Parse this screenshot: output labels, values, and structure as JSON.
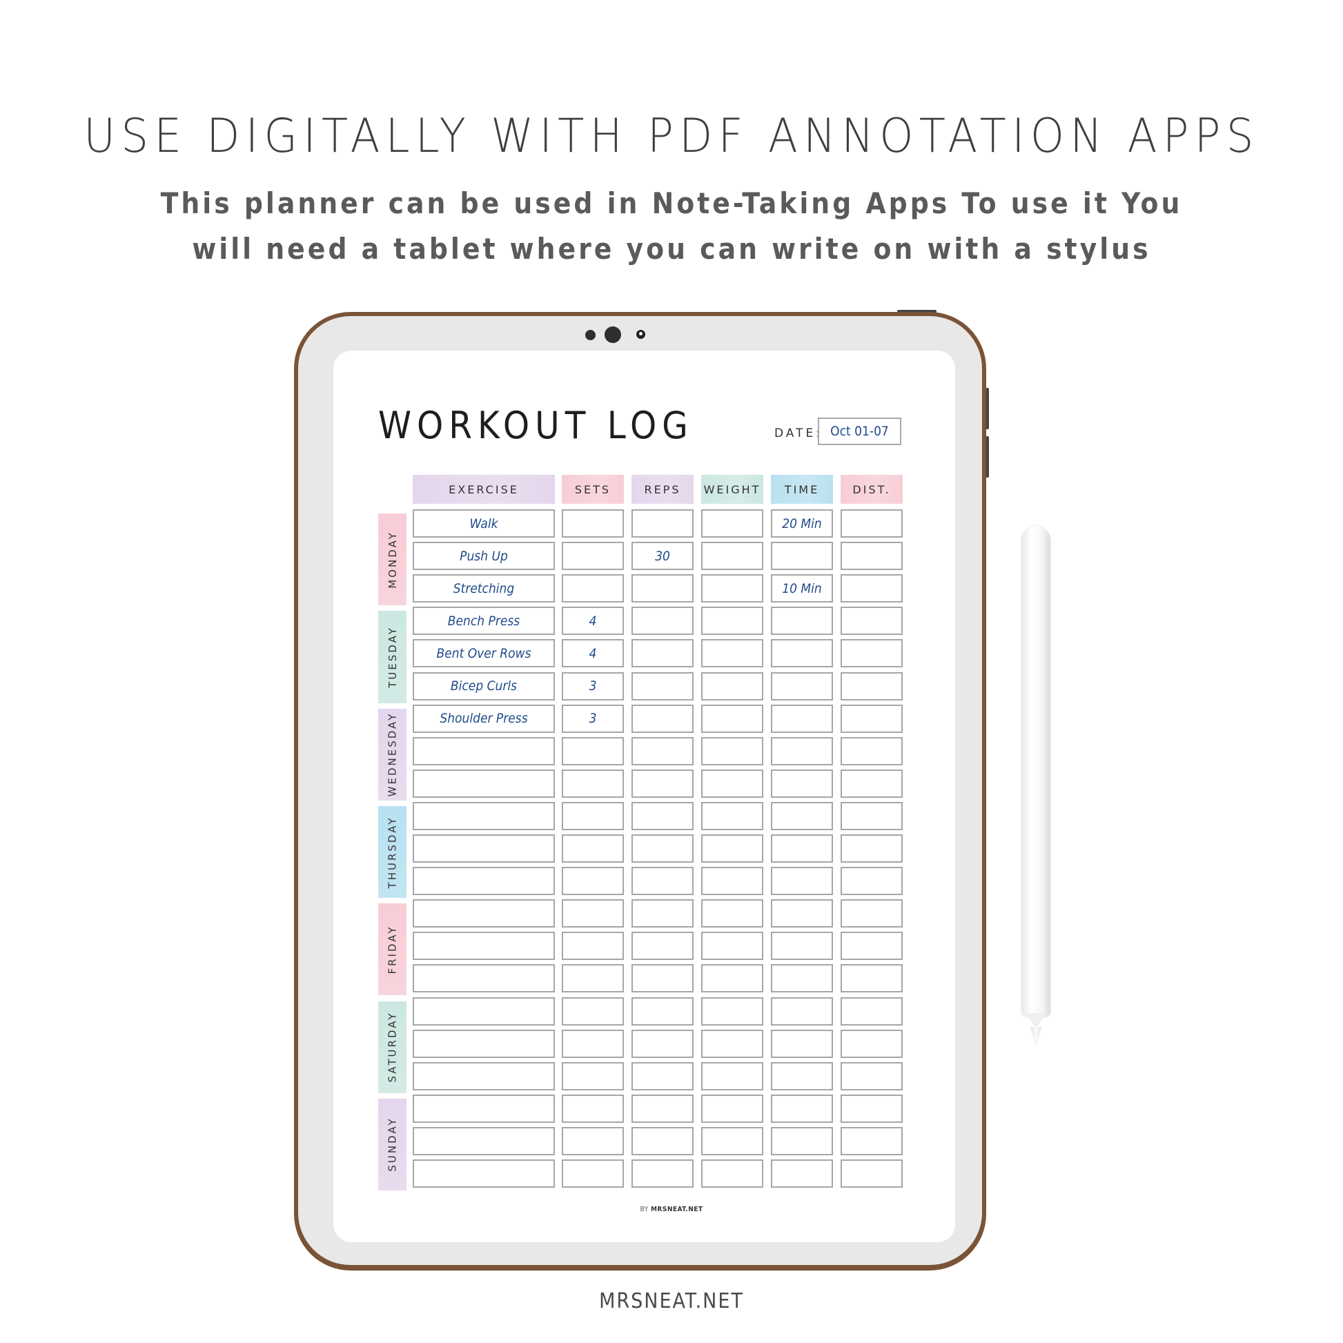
{
  "banner": {
    "heading": "USE DIGITALLY WITH PDF ANNOTATION APPS",
    "subtitle_line1": "This planner can be used in Note-Taking Apps  To use it You",
    "subtitle_line2": "will need a tablet where you can write on with a stylus"
  },
  "device": {
    "frame_color": "#7b5336",
    "bezel_color": "#e8e8e8",
    "icons": [
      "camera-sensor-icon",
      "camera-icon",
      "camera-lens-icon",
      "stylus-pencil-icon"
    ]
  },
  "planner": {
    "title": "WORKOUT LOG",
    "date_label": "DATE:",
    "date_value": "Oct 01-07",
    "columns": [
      {
        "label": "EXERCISE",
        "color": "#e4d6ec"
      },
      {
        "label": "SETS",
        "color": "#f7cdd6"
      },
      {
        "label": "REPS",
        "color": "#e4d6ec"
      },
      {
        "label": "WEIGHT",
        "color": "#cce7e1"
      },
      {
        "label": "TIME",
        "color": "#b8e1f0"
      },
      {
        "label": "DIST.",
        "color": "#f7cdd6"
      }
    ],
    "days": [
      {
        "label": "MONDAY",
        "color": "#f7cdd6",
        "rows": [
          [
            "Walk",
            "",
            "",
            "",
            "20 Min",
            ""
          ],
          [
            "Push Up",
            "",
            "30",
            "",
            "",
            ""
          ],
          [
            "Stretching",
            "",
            "",
            "",
            "10 Min",
            ""
          ]
        ]
      },
      {
        "label": "TUESDAY",
        "color": "#cce7e1",
        "rows": [
          [
            "Bench Press",
            "4",
            "",
            "",
            "",
            ""
          ],
          [
            "Bent Over Rows",
            "4",
            "",
            "",
            "",
            ""
          ],
          [
            "Bicep Curls",
            "3",
            "",
            "",
            "",
            ""
          ]
        ]
      },
      {
        "label": "WEDNESDAY",
        "color": "#e4d6ec",
        "rows": [
          [
            "Shoulder Press",
            "3",
            "",
            "",
            "",
            ""
          ],
          [
            "",
            "",
            "",
            "",
            "",
            ""
          ],
          [
            "",
            "",
            "",
            "",
            "",
            ""
          ]
        ]
      },
      {
        "label": "THURSDAY",
        "color": "#b8e1f0",
        "rows": [
          [
            "",
            "",
            "",
            "",
            "",
            ""
          ],
          [
            "",
            "",
            "",
            "",
            "",
            ""
          ],
          [
            "",
            "",
            "",
            "",
            "",
            ""
          ]
        ]
      },
      {
        "label": "FRIDAY",
        "color": "#f7cdd6",
        "rows": [
          [
            "",
            "",
            "",
            "",
            "",
            ""
          ],
          [
            "",
            "",
            "",
            "",
            "",
            ""
          ],
          [
            "",
            "",
            "",
            "",
            "",
            ""
          ]
        ]
      },
      {
        "label": "SATURDAY",
        "color": "#cce7e1",
        "rows": [
          [
            "",
            "",
            "",
            "",
            "",
            ""
          ],
          [
            "",
            "",
            "",
            "",
            "",
            ""
          ],
          [
            "",
            "",
            "",
            "",
            "",
            ""
          ]
        ]
      },
      {
        "label": "SUNDAY",
        "color": "#e4d6ec",
        "rows": [
          [
            "",
            "",
            "",
            "",
            "",
            ""
          ],
          [
            "",
            "",
            "",
            "",
            "",
            ""
          ],
          [
            "",
            "",
            "",
            "",
            "",
            ""
          ]
        ]
      }
    ],
    "footer_by": "BY",
    "footer_brand": "MRSNEAT.NET"
  },
  "brand": "MRSNEAT.NET"
}
